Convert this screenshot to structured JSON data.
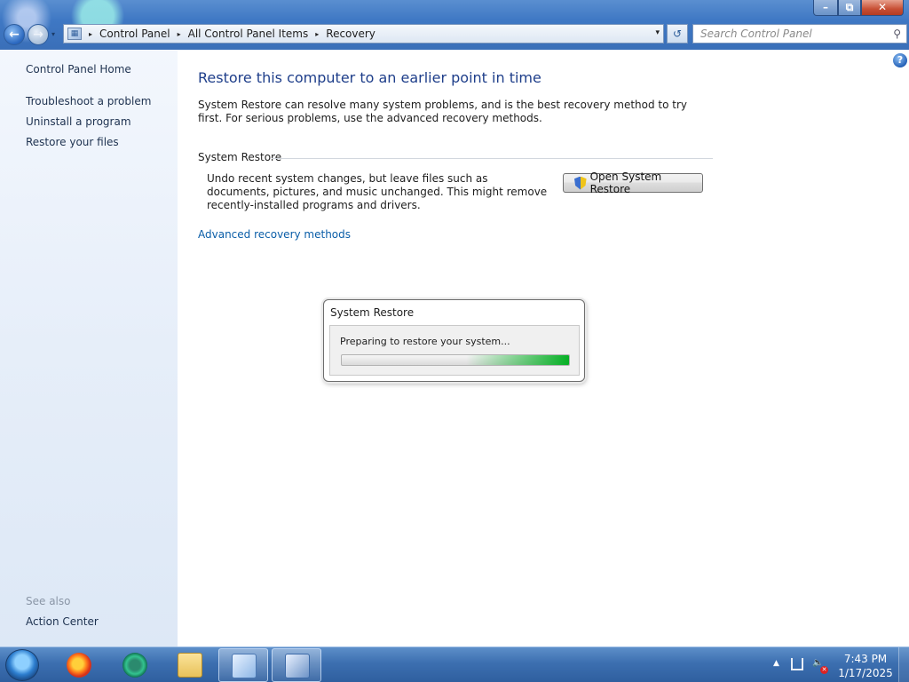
{
  "window": {
    "minimize_glyph": "–",
    "maximize_glyph": "⧉",
    "close_glyph": "✕"
  },
  "nav": {
    "back_glyph": "←",
    "forward_glyph": "→",
    "dropdown_glyph": "▾"
  },
  "address": {
    "crumbs": [
      "Control Panel",
      "All Control Panel Items",
      "Recovery"
    ],
    "separator": "▸"
  },
  "search": {
    "placeholder": "Search Control Panel"
  },
  "sidebar": {
    "home": "Control Panel Home",
    "items": [
      "Troubleshoot a problem",
      "Uninstall a program",
      "Restore your files"
    ],
    "see_also_label": "See also",
    "see_also_items": [
      "Action Center"
    ]
  },
  "main": {
    "title": "Restore this computer to an earlier point in time",
    "intro": "System Restore can resolve many system problems, and is the best recovery method to try first. For serious problems, use the advanced recovery methods.",
    "section_title": "System Restore",
    "section_desc": "Undo recent system changes, but leave files such as documents, pictures, and music unchanged. This might remove recently-installed programs and drivers.",
    "open_button": "Open System Restore",
    "advanced_link": "Advanced recovery methods"
  },
  "dialog": {
    "title": "System Restore",
    "message": "Preparing to restore your system...",
    "progress_state": "marquee (indeterminate)"
  },
  "taskbar": {
    "pinned": [
      "start-orb",
      "firefox-icon",
      "edge-icon",
      "folder-icon",
      "control-panel-icon",
      "system-restore-icon"
    ],
    "time": "7:43 PM",
    "date": "1/17/2025"
  },
  "colors": {
    "title_blue": "#1e3e8a",
    "link_blue": "#0b5ea8",
    "progress_green": "#06b025",
    "taskbar_blue": "#3c6fb0"
  }
}
